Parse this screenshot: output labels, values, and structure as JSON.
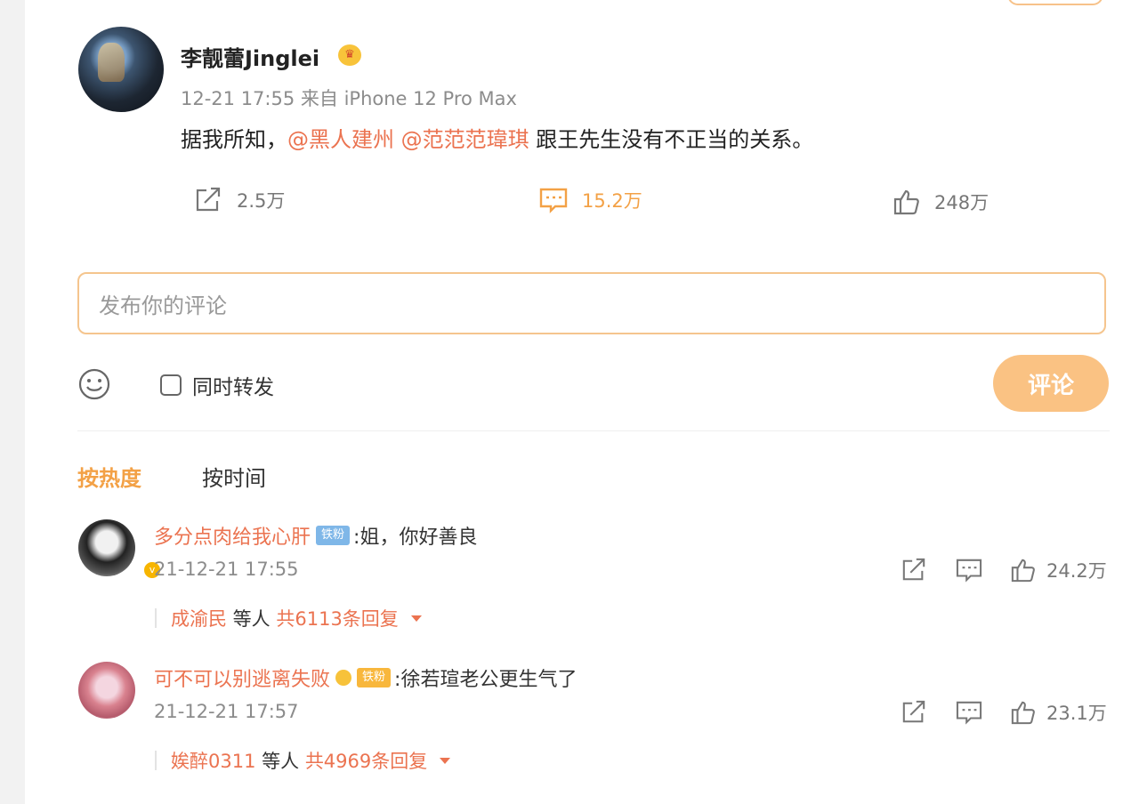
{
  "post": {
    "username": "李靓蕾Jinglei",
    "meta": "12-21 17:55 来自 iPhone 12 Pro Max",
    "content_prefix": "据我所知，",
    "mention_1": "@黑人建州",
    "mention_2": "@范范范瑋琪",
    "content_suffix": "跟王先生没有不正当的关系。",
    "share_count": "2.5万",
    "comment_count": "15.2万",
    "like_count": "248万"
  },
  "composer": {
    "placeholder": "发布你的评论",
    "forward_label": "同时转发",
    "submit_label": "评论"
  },
  "sort_tabs": {
    "hot": "按热度",
    "time": "按时间"
  },
  "comments": [
    {
      "name": "多分点肉给我心肝",
      "badge": "铁粉",
      "text": ":姐，你好善良",
      "time": "21-12-21 17:55",
      "likes": "24.2万",
      "reply_user": "成渝民",
      "reply_mid": " 等人 ",
      "reply_total": "共6113条回复"
    },
    {
      "name": "可不可以别逃离失败",
      "badge": "铁粉",
      "text": ":徐若瑄老公更生气了",
      "time": "21-12-21 17:57",
      "likes": "23.1万",
      "reply_user": "娭醉0311",
      "reply_mid": " 等人 ",
      "reply_total": "共4969条回复"
    }
  ],
  "colors": {
    "accent": "#f3a146",
    "link": "#eb7350",
    "button": "#fac283"
  }
}
